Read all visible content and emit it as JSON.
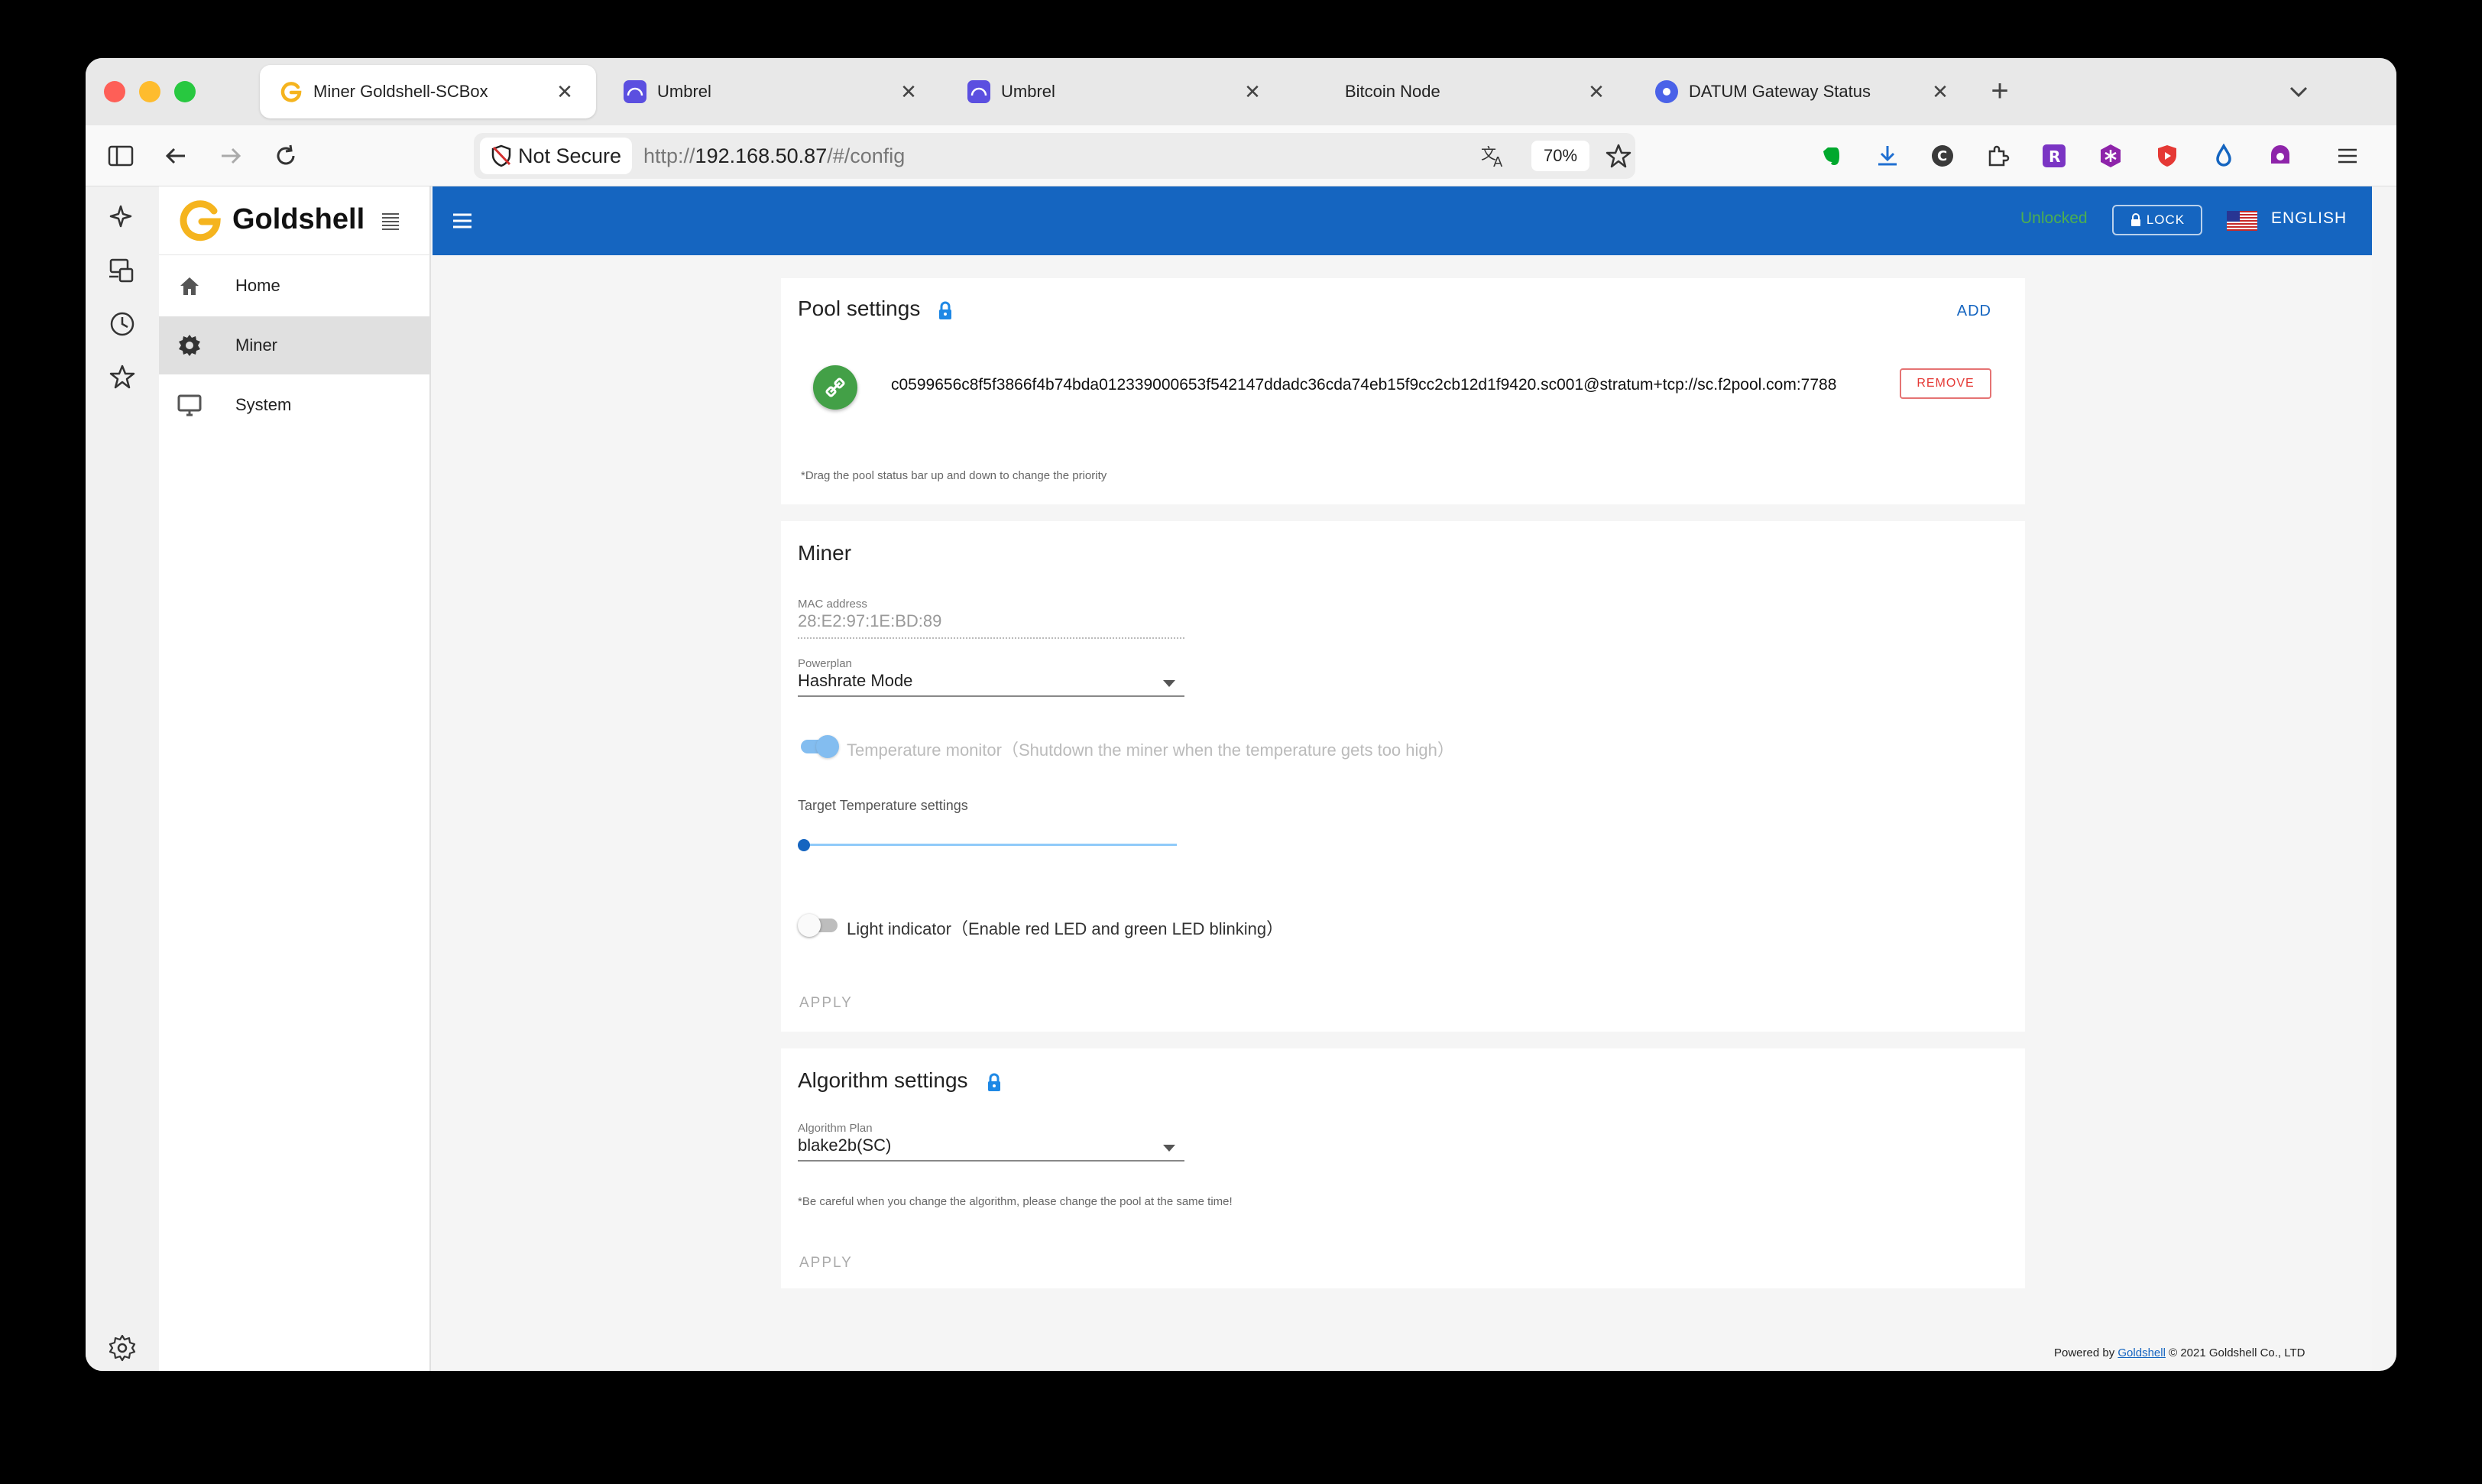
{
  "browser": {
    "tabs": [
      {
        "title": "Miner Goldshell-SCBox",
        "active": true,
        "favicon": "goldshell-g-icon"
      },
      {
        "title": "Umbrel",
        "active": false,
        "favicon": "umbrel-icon"
      },
      {
        "title": "Umbrel",
        "active": false,
        "favicon": "umbrel-icon"
      },
      {
        "title": "Bitcoin Node",
        "active": false,
        "favicon": ""
      },
      {
        "title": "DATUM Gateway Status",
        "active": false,
        "favicon": "datum-icon"
      }
    ],
    "security_label": "Not Secure",
    "url_prefix": "http://",
    "url_host": "192.168.50.87",
    "url_path": "/#/config",
    "zoom": "70%"
  },
  "app": {
    "brand": "Goldshell",
    "nav": [
      {
        "label": "Home",
        "icon": "home-icon",
        "selected": false
      },
      {
        "label": "Miner",
        "icon": "gear-icon",
        "selected": true
      },
      {
        "label": "System",
        "icon": "monitor-icon",
        "selected": false
      }
    ],
    "topbar": {
      "status": "Unlocked",
      "lock_label": "LOCK",
      "language": "ENGLISH"
    }
  },
  "pool_settings": {
    "title": "Pool settings",
    "add_label": "ADD",
    "pool_url": "c0599656c8f5f3866f4b74bda012339000653f542147ddadc36cda74eb15f9cc2cb12d1f9420.sc001@stratum+tcp://sc.f2pool.com:7788",
    "remove_label": "REMOVE",
    "hint": "*Drag the pool status bar up and down to change the priority"
  },
  "miner": {
    "title": "Miner",
    "mac_label": "MAC address",
    "mac_value": "28:E2:97:1E:BD:89",
    "powerplan_label": "Powerplan",
    "powerplan_value": "Hashrate Mode",
    "temp_monitor_label": "Temperature monitor（Shutdown the miner when the temperature gets too high）",
    "temp_monitor_on": true,
    "target_temp_label": "Target Temperature settings",
    "target_temp_fraction": 0.0,
    "light_label": "Light indicator（Enable red LED and green LED blinking）",
    "light_on": false,
    "apply_label": "APPLY"
  },
  "algorithm": {
    "title": "Algorithm settings",
    "plan_label": "Algorithm Plan",
    "plan_value": "blake2b(SC)",
    "hint": "*Be careful when you change the algorithm, please change the pool at the same time!",
    "apply_label": "APPLY"
  },
  "footer": {
    "prefix": "Powered by",
    "link": "Goldshell",
    "suffix": "© 2021 Goldshell Co., LTD"
  },
  "colors": {
    "accent": "#1565c0",
    "success": "#4caf50",
    "danger": "#e53935",
    "brand_gold": "#f5b41e"
  }
}
